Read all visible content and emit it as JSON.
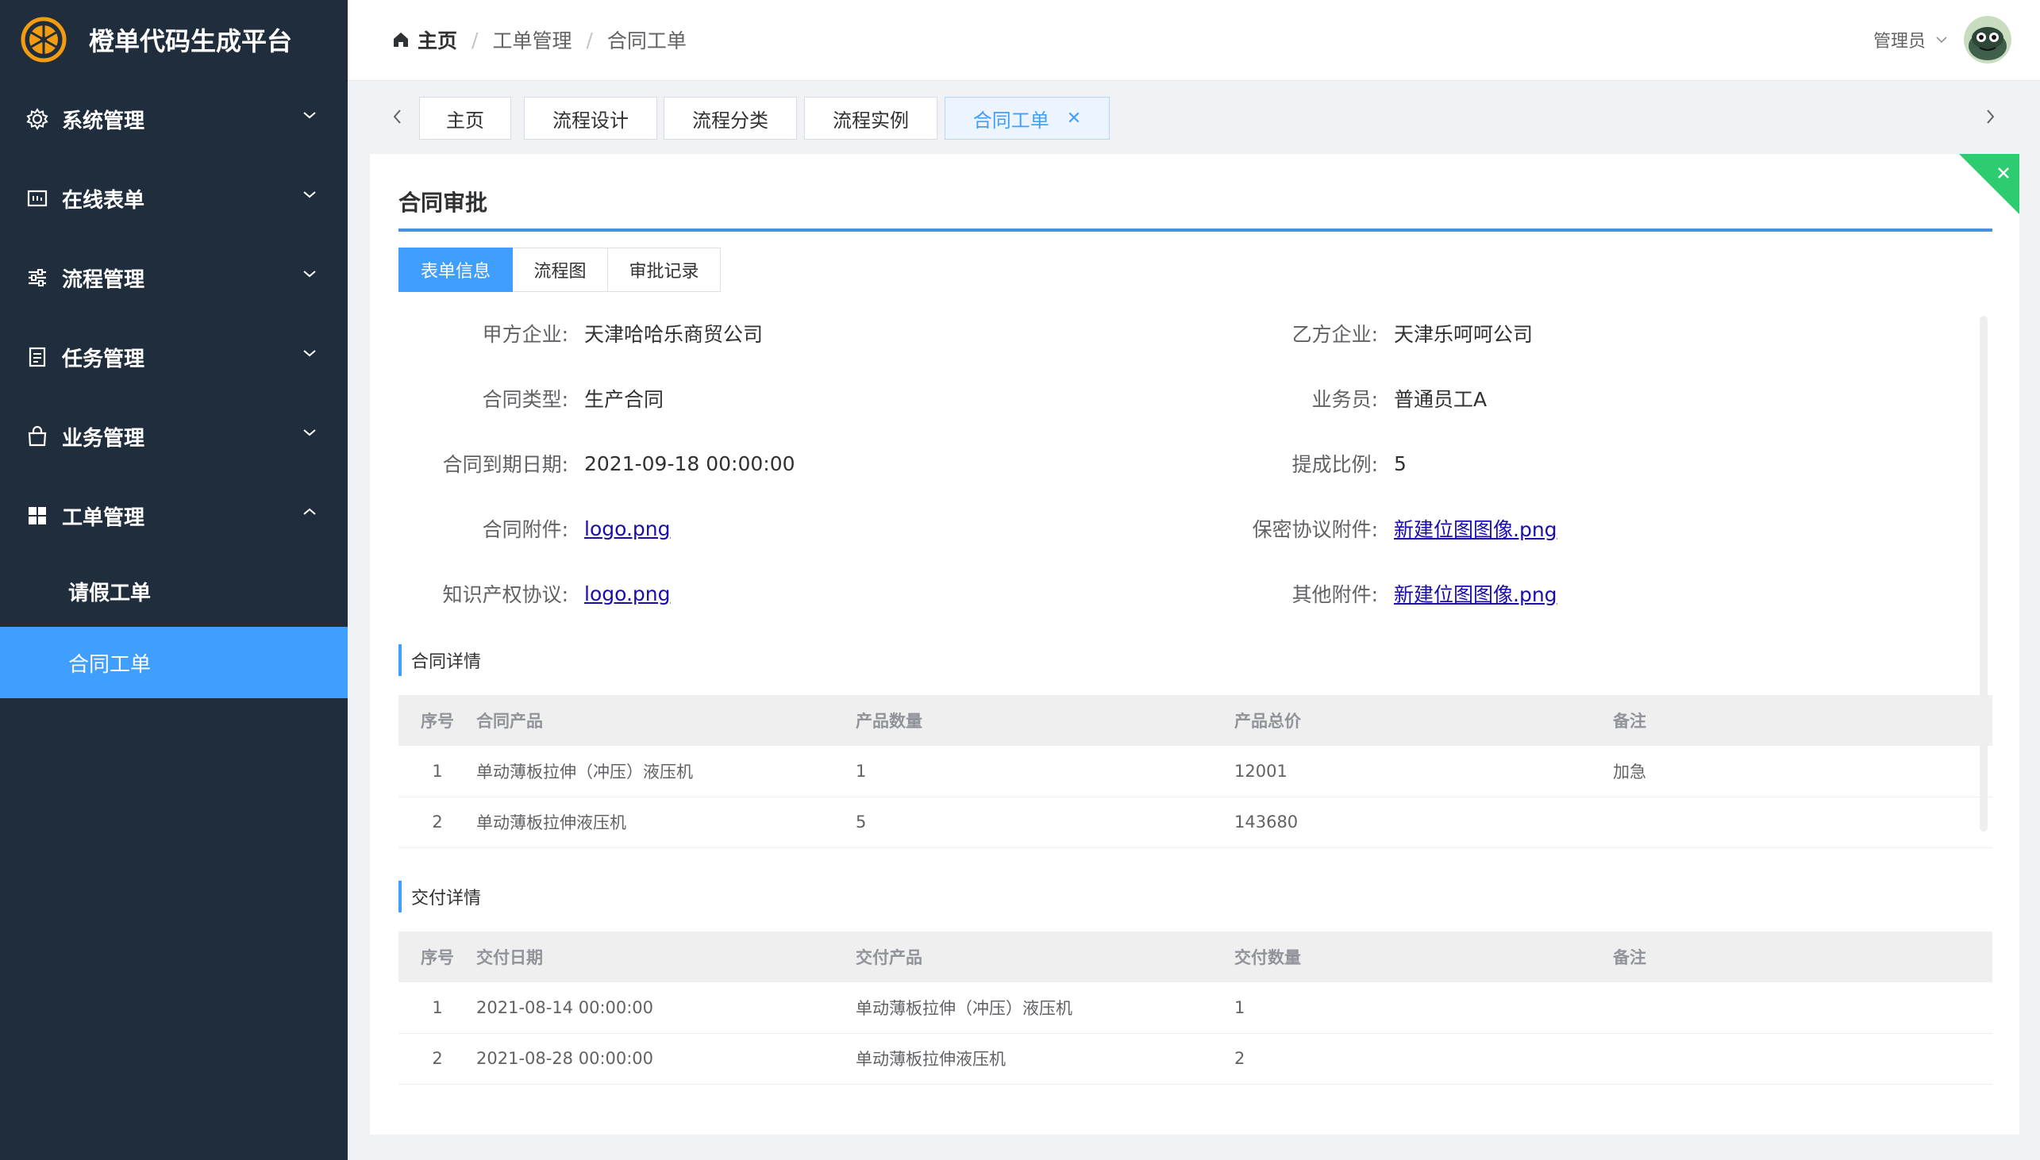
{
  "app": {
    "title": "橙单代码生成平台"
  },
  "sidebar": {
    "menus": [
      {
        "label": "系统管理",
        "icon": "gear-icon"
      },
      {
        "label": "在线表单",
        "icon": "form-icon"
      },
      {
        "label": "流程管理",
        "icon": "sliders-icon"
      },
      {
        "label": "任务管理",
        "icon": "document-icon"
      },
      {
        "label": "业务管理",
        "icon": "bag-icon"
      },
      {
        "label": "工单管理",
        "icon": "grid-icon"
      }
    ],
    "submenu": [
      {
        "label": "请假工单"
      },
      {
        "label": "合同工单"
      }
    ]
  },
  "header": {
    "breadcrumb": [
      "主页",
      "工单管理",
      "合同工单"
    ],
    "user": "管理员"
  },
  "tags": [
    "主页",
    "流程设计",
    "流程分类",
    "流程实例",
    "合同工单"
  ],
  "card": {
    "title": "合同审批",
    "tabs": [
      "表单信息",
      "流程图",
      "审批记录"
    ],
    "fields": {
      "party_a_label": "甲方企业:",
      "party_a": "天津哈哈乐商贸公司",
      "party_b_label": "乙方企业:",
      "party_b": "天津乐呵呵公司",
      "type_label": "合同类型:",
      "type": "生产合同",
      "sales_label": "业务员:",
      "sales": "普通员工A",
      "expire_label": "合同到期日期:",
      "expire": "2021-09-18 00:00:00",
      "commission_label": "提成比例:",
      "commission": "5",
      "attach_label": "合同附件:",
      "attach": "logo.png",
      "nda_label": "保密协议附件:",
      "nda": "新建位图图像.png",
      "ip_label": "知识产权协议:",
      "ip": "logo.png",
      "other_label": "其他附件:",
      "other": "新建位图图像.png"
    },
    "contract_section": "合同详情",
    "contract_table": {
      "headers": [
        "序号",
        "合同产品",
        "产品数量",
        "产品总价",
        "备注"
      ],
      "rows": [
        [
          "1",
          "单动薄板拉伸（冲压）液压机",
          "1",
          "12001",
          "加急"
        ],
        [
          "2",
          "单动薄板拉伸液压机",
          "5",
          "143680",
          ""
        ]
      ]
    },
    "delivery_section": "交付详情",
    "delivery_table": {
      "headers": [
        "序号",
        "交付日期",
        "交付产品",
        "交付数量",
        "备注"
      ],
      "rows": [
        [
          "1",
          "2021-08-14 00:00:00",
          "单动薄板拉伸（冲压）液压机",
          "1",
          ""
        ],
        [
          "2",
          "2021-08-28 00:00:00",
          "单动薄板拉伸液压机",
          "2",
          ""
        ]
      ]
    }
  },
  "colors": {
    "sidebar_bg": "#1f2d3d",
    "accent": "#409eff",
    "logo": "#f39c12",
    "corner": "#2ecc71"
  }
}
